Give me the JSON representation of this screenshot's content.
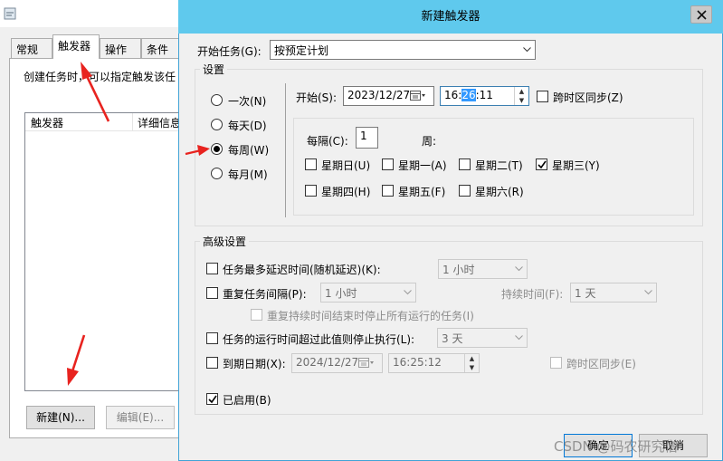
{
  "background_window": {
    "tabs": [
      "常规",
      "触发器",
      "操作",
      "条件"
    ],
    "description": "创建任务时，可以指定触发该任",
    "list_headers": [
      "触发器",
      "详细信息"
    ],
    "new_button": "新建(N)...",
    "edit_button": "编辑(E)..."
  },
  "dialog": {
    "title": "新建触发器",
    "begin_task_label": "开始任务(G):",
    "begin_task_value": "按预定计划",
    "settings_title": "设置",
    "schedule_options": [
      {
        "label": "一次(N)",
        "selected": false
      },
      {
        "label": "每天(D)",
        "selected": false
      },
      {
        "label": "每周(W)",
        "selected": true
      },
      {
        "label": "每月(M)",
        "selected": false
      }
    ],
    "start_label": "开始(S):",
    "start_date": "2023/12/27",
    "start_time_prefix": "16:",
    "start_time_selected": "26",
    "start_time_suffix": ":11",
    "sync_timezone_label": "跨时区同步(Z)",
    "every_label": "每隔(C):",
    "every_value": "1",
    "week_unit": "周:",
    "weekdays": [
      {
        "label": "星期日(U)",
        "checked": false
      },
      {
        "label": "星期一(A)",
        "checked": false
      },
      {
        "label": "星期二(T)",
        "checked": false
      },
      {
        "label": "星期三(Y)",
        "checked": true
      },
      {
        "label": "星期四(H)",
        "checked": false
      },
      {
        "label": "星期五(F)",
        "checked": false
      },
      {
        "label": "星期六(R)",
        "checked": false
      }
    ],
    "advanced_title": "高级设置",
    "delay_label": "任务最多延迟时间(随机延迟)(K):",
    "delay_value": "1 小时",
    "repeat_label": "重复任务间隔(P):",
    "repeat_value": "1 小时",
    "duration_label": "持续时间(F):",
    "duration_value": "1 天",
    "stop_all_label": "重复持续时间结束时停止所有运行的任务(I)",
    "stop_longer_label": "任务的运行时间超过此值则停止执行(L):",
    "stop_longer_value": "3 天",
    "expire_label": "到期日期(X):",
    "expire_date": "2024/12/27",
    "expire_time": "16:25:12",
    "expire_sync_label": "跨时区同步(E)",
    "enabled_label": "已启用(B)",
    "enabled_checked": true,
    "ok_button": "确定",
    "cancel_button": "取消"
  },
  "watermark": "CSDN @码农研究僧",
  "colors": {
    "title_bar": "#5fc9ed",
    "arrow": "#e8231f",
    "selection": "#3399ff"
  }
}
